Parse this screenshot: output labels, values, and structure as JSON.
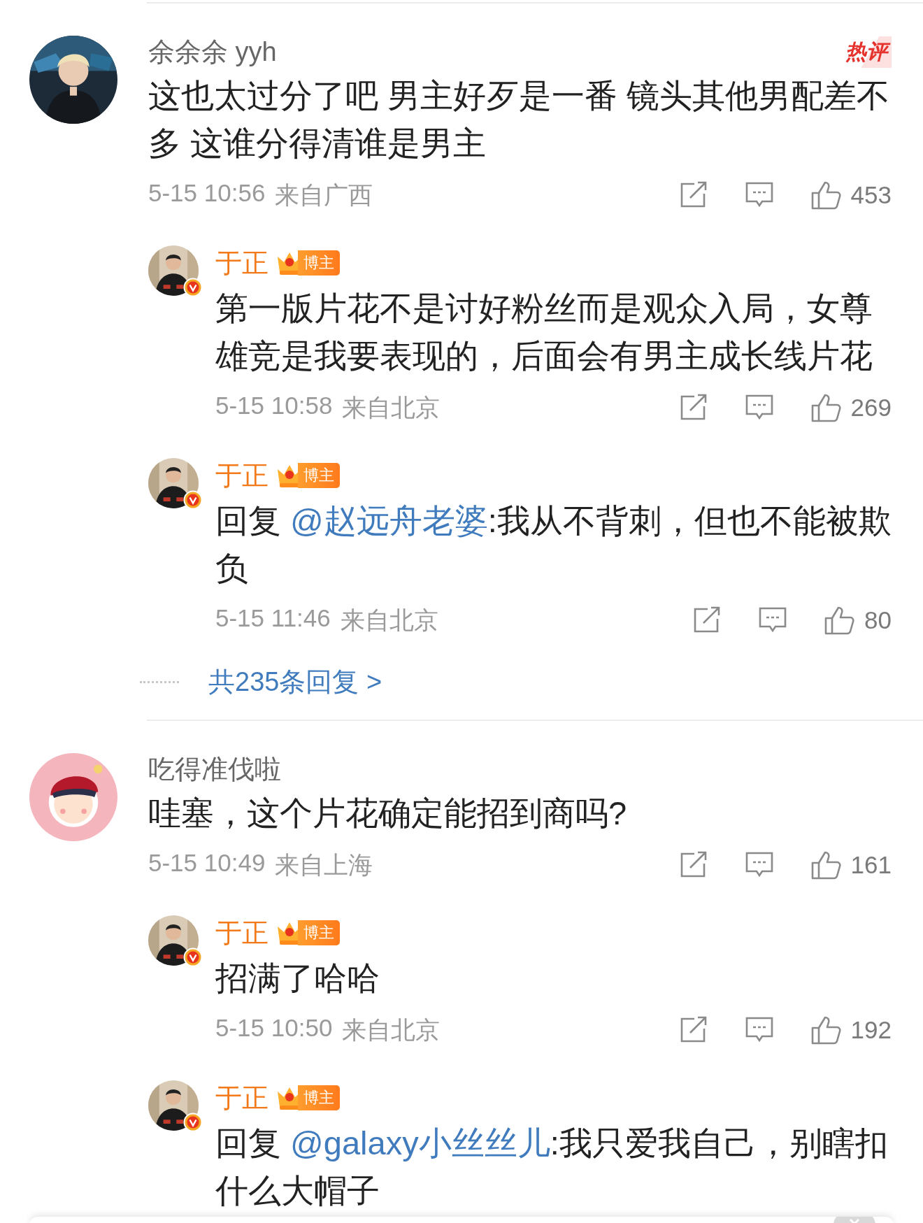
{
  "comments": [
    {
      "user": "余余余 yyh",
      "hot_label": "热评",
      "text": "这也太过分了吧 男主好歹是一番 镜头其他男配差不多 这谁分得清谁是男主",
      "time": "5-15 10:56",
      "location": "来自广西",
      "likes": "453",
      "replies": [
        {
          "user": "于正",
          "badge": "博主",
          "verified": true,
          "text": "第一版片花不是讨好粉丝而是观众入局，女尊雄竞是我要表现的，后面会有男主成长线片花",
          "time": "5-15 10:58",
          "location": "来自北京",
          "likes": "269"
        },
        {
          "user": "于正",
          "badge": "博主",
          "verified": true,
          "prefix": "回复 ",
          "mention": "@赵远舟老婆",
          "text": ":我从不背刺，但也不能被欺负",
          "time": "5-15 11:46",
          "location": "来自北京",
          "likes": "80"
        }
      ],
      "more_replies": "共235条回复 >"
    },
    {
      "user": "吃得准伐啦",
      "avatar": {
        "kind": "cartoon"
      },
      "text": "哇塞，这个片花确定能招到商吗?",
      "time": "5-15 10:49",
      "location": "来自上海",
      "likes": "161",
      "replies": [
        {
          "user": "于正",
          "badge": "博主",
          "verified": true,
          "text": "招满了哈哈",
          "time": "5-15 10:50",
          "location": "来自北京",
          "likes": "192"
        },
        {
          "user": "于正",
          "badge": "博主",
          "verified": true,
          "prefix": "回复 ",
          "mention": "@galaxy小丝丝儿",
          "text": ":我只爱我自己，别瞎扣什么大帽子"
        }
      ]
    }
  ]
}
